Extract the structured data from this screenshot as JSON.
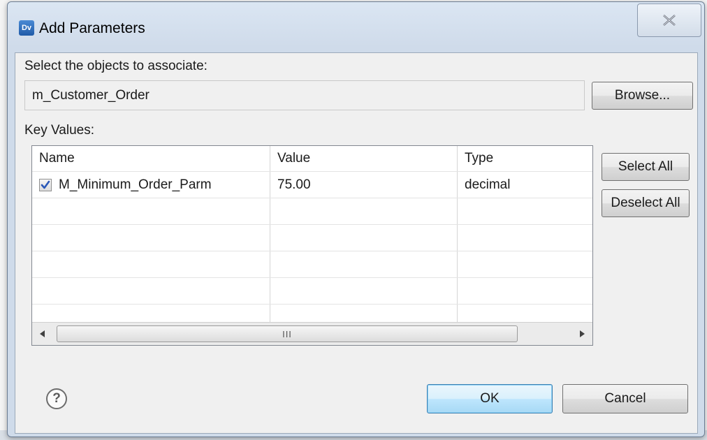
{
  "dialog": {
    "app_icon_text": "Dv",
    "title": "Add Parameters"
  },
  "select_objects": {
    "label": "Select the objects to associate:",
    "value": "m_Customer_Order",
    "browse_label": "Browse..."
  },
  "key_values": {
    "label": "Key Values:",
    "columns": [
      "Name",
      "Value",
      "Type"
    ],
    "rows": [
      {
        "checked": true,
        "name": "M_Minimum_Order_Parm",
        "value": "75.00",
        "type": "decimal"
      }
    ],
    "select_all_label": "Select All",
    "deselect_all_label": "Deselect All"
  },
  "scrollbar": {
    "grip": "III"
  },
  "footer": {
    "help_glyph": "?",
    "ok_label": "OK",
    "cancel_label": "Cancel"
  },
  "colors": {
    "ok_accent": "#3c7fb1",
    "check_mark": "#2a58b8",
    "title_bar": "#cfdbea"
  }
}
